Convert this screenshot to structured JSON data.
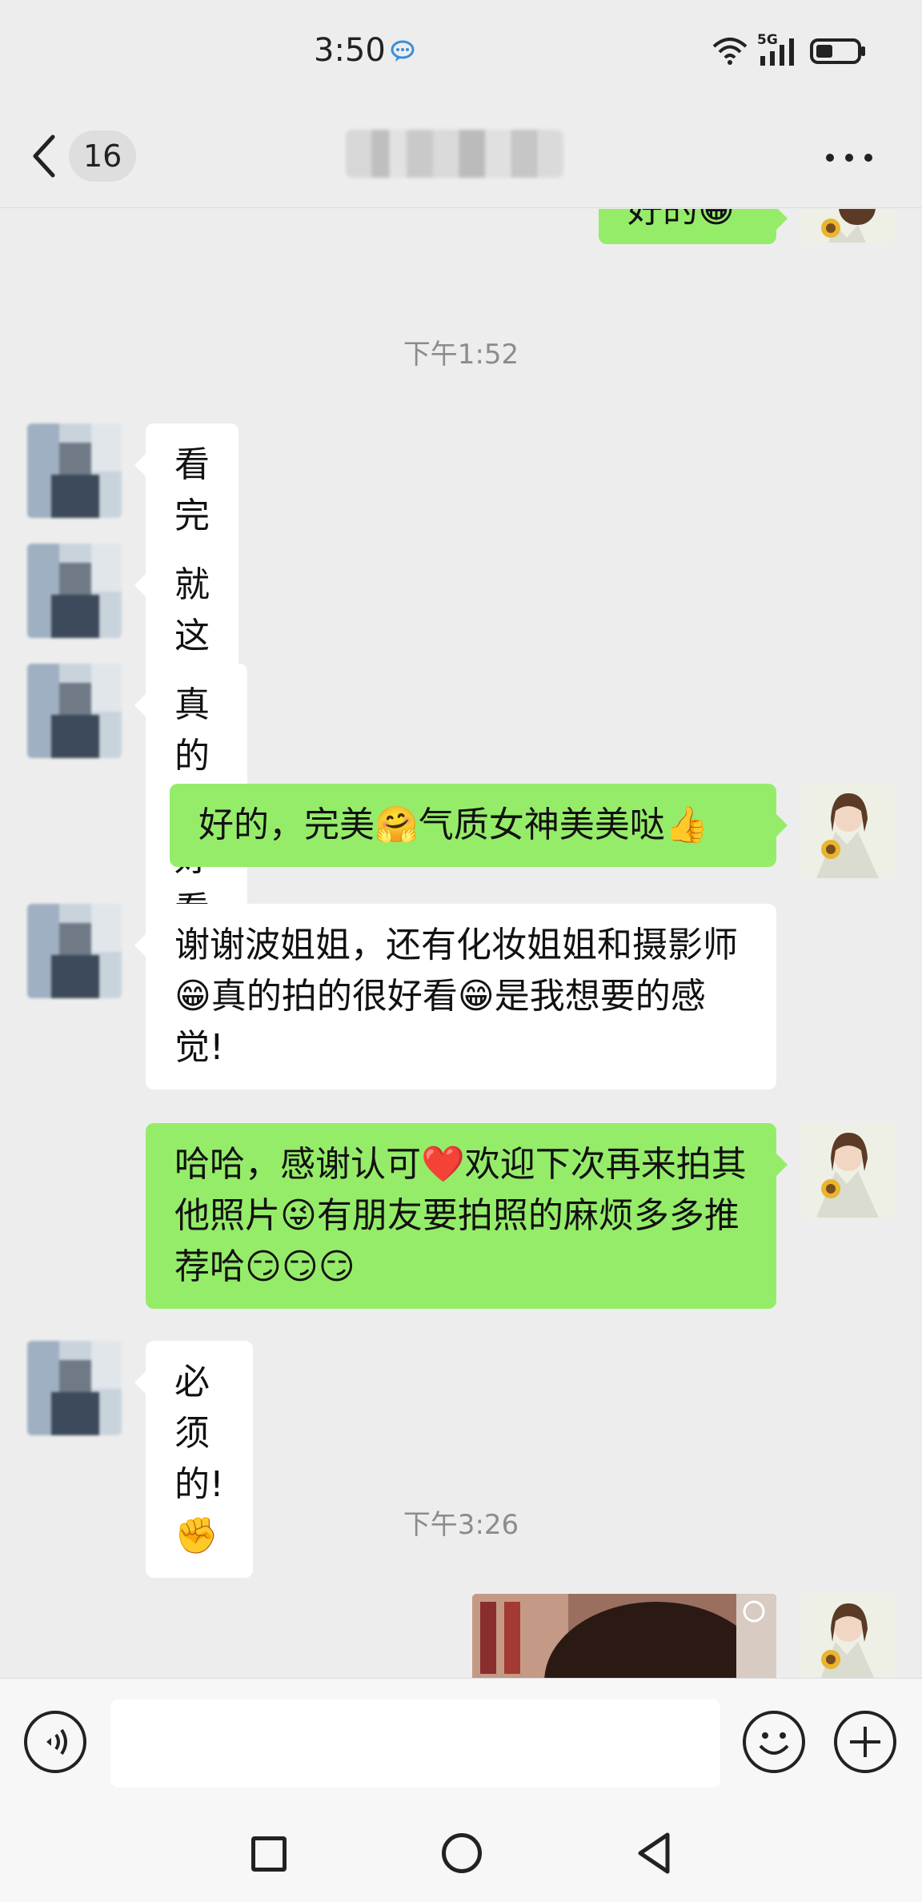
{
  "status_bar": {
    "time": "3:50",
    "network": "5G",
    "icons": [
      "chat-bubble-icon",
      "wifi-icon",
      "signal-icon",
      "battery-icon"
    ]
  },
  "title_bar": {
    "unread_count": "16",
    "more_icon": "more-dots-icon"
  },
  "timestamps": {
    "t1": "下午1:52",
    "t2": "下午3:26"
  },
  "messages": {
    "m0": {
      "sender": "me",
      "text": "好的😁"
    },
    "m1": {
      "sender": "friend",
      "text": "看完啦"
    },
    "m2": {
      "sender": "friend",
      "text": "就这样就可以了"
    },
    "m3": {
      "sender": "friend",
      "text": "真的很好看🤭🤭"
    },
    "m4": {
      "sender": "me",
      "text": "好的，完美🤗气质女神美美哒👍"
    },
    "m5": {
      "sender": "friend",
      "text": "谢谢波姐姐，还有化妆姐姐和摄影师😁真的拍的很好看😁是我想要的感觉!"
    },
    "m6": {
      "sender": "me",
      "text": "哈哈，感谢认可❤️欢迎下次再来拍其他照片😜有朋友要拍照的麻烦多多推荐哈😏😏😏"
    },
    "m7": {
      "sender": "friend",
      "text": "必须的!✊"
    },
    "m8": {
      "sender": "me",
      "type": "image"
    }
  },
  "input_bar": {
    "placeholder": "",
    "icons": [
      "voice-icon",
      "emoji-icon",
      "plus-icon"
    ]
  },
  "nav_bar": {
    "icons": [
      "recents-square-icon",
      "home-circle-icon",
      "back-triangle-icon"
    ]
  },
  "colors": {
    "background": "#ededed",
    "bubble_me": "#95ec69",
    "bubble_friend": "#ffffff",
    "timestamp": "#8c8c8c"
  }
}
